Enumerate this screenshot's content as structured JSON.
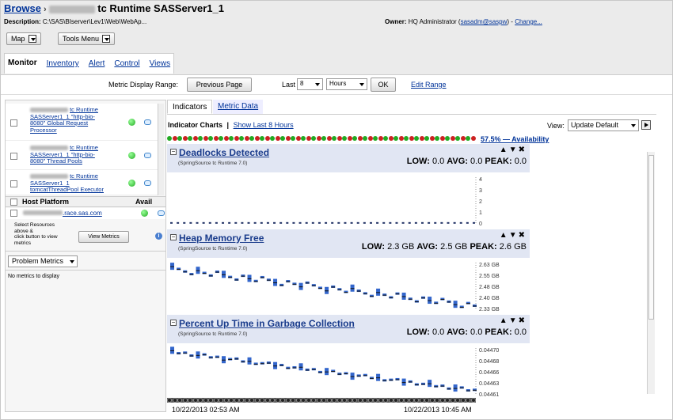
{
  "header": {
    "breadcrumb_link": "Browse",
    "breadcrumb_title": "tc Runtime SASServer1_1",
    "description_label": "Description:",
    "description_value": "C:\\SAS\\BIserver\\Lev1\\Web\\WebAp...",
    "owner_label": "Owner:",
    "owner_name": "HQ Administrator (",
    "owner_user": "sasadm@saspw",
    "owner_close": ")",
    "change_link": "Change..."
  },
  "toolbar": {
    "map_label": "Map",
    "tools_label": "Tools Menu"
  },
  "tabs": [
    {
      "label": "Monitor",
      "active": true
    },
    {
      "label": "Inventory"
    },
    {
      "label": "Alert"
    },
    {
      "label": "Control"
    },
    {
      "label": "Views"
    }
  ],
  "range": {
    "label": "Metric Display Range:",
    "prev_button": "Previous Page",
    "last_label": "Last",
    "last_value": "8",
    "unit_value": "Hours",
    "ok_button": "OK",
    "edit_range": "Edit Range"
  },
  "left": {
    "resources": [
      {
        "line1": "tc Runtime",
        "line2": "SASServer1_1 \"http-bio-",
        "line3": "8080\" Global Request",
        "line4": "Processor"
      },
      {
        "line1": "tc Runtime",
        "line2": "SASServer1_1 \"http-bio-",
        "line3": "8080\" Thread Pools",
        "line4": ""
      },
      {
        "line1": "tc Runtime",
        "line2": "SASServer1_1",
        "line3": "tomcatThreadPool Executor",
        "line4": ""
      }
    ],
    "host_platform_label": "Host Platform",
    "avail_label": "Avail",
    "host_name": ".race.sas.com",
    "select_text_1": "Select Resources",
    "select_text_2": "above &",
    "select_text_3": "click button to view",
    "select_text_4": "metrics",
    "view_metrics_button": "View Metrics",
    "problem_metrics_label": "Problem Metrics",
    "no_metrics_text": "No metrics to display"
  },
  "panel": {
    "tab_indicators": "Indicators",
    "tab_metric_data": "Metric Data",
    "indicator_charts_label": "Indicator Charts",
    "pipe": "|",
    "show_last": "Show Last 8 Hours",
    "view_label": "View:",
    "view_value": "Update Default",
    "availability_text": "57.5% — Availability",
    "start_time": "10/22/2013 02:53 AM",
    "end_time": "10/22/2013 10:45 AM"
  },
  "charts": [
    {
      "title": "Deadlocks Detected",
      "subtitle": "(SpringSource tc Runtime 7.0)",
      "low_label": "LOW:",
      "low": "0.0",
      "avg_label": "AVG:",
      "avg": "0.0",
      "peak_label": "PEAK:",
      "peak": "0.0",
      "ticks": [
        "4",
        "3",
        "2",
        "1",
        "0"
      ]
    },
    {
      "title": "Heap Memory Free",
      "subtitle": "(SpringSource tc Runtime 7.0)",
      "low_label": "LOW:",
      "low": "2.3 GB",
      "avg_label": "AVG:",
      "avg": "2.5 GB",
      "peak_label": "PEAK:",
      "peak": "2.6 GB",
      "ticks": [
        "2.63 GB",
        "2.55 GB",
        "2.48 GB",
        "2.40 GB",
        "2.33 GB"
      ]
    },
    {
      "title": "Percent Up Time in Garbage Collection",
      "subtitle": "(SpringSource tc Runtime 7.0)",
      "low_label": "LOW:",
      "low": "0.0",
      "avg_label": "AVG:",
      "avg": "0.0",
      "peak_label": "PEAK:",
      "peak": "0.0",
      "ticks": [
        "0.04470",
        "0.04468",
        "0.04466",
        "0.04463",
        "0.04461"
      ]
    }
  ],
  "colors": {
    "link": "#003399",
    "header_band": "#e1e6f3",
    "marker": "#3366cc",
    "avail_green": "#22aa22",
    "avail_red": "#cc2222"
  }
}
